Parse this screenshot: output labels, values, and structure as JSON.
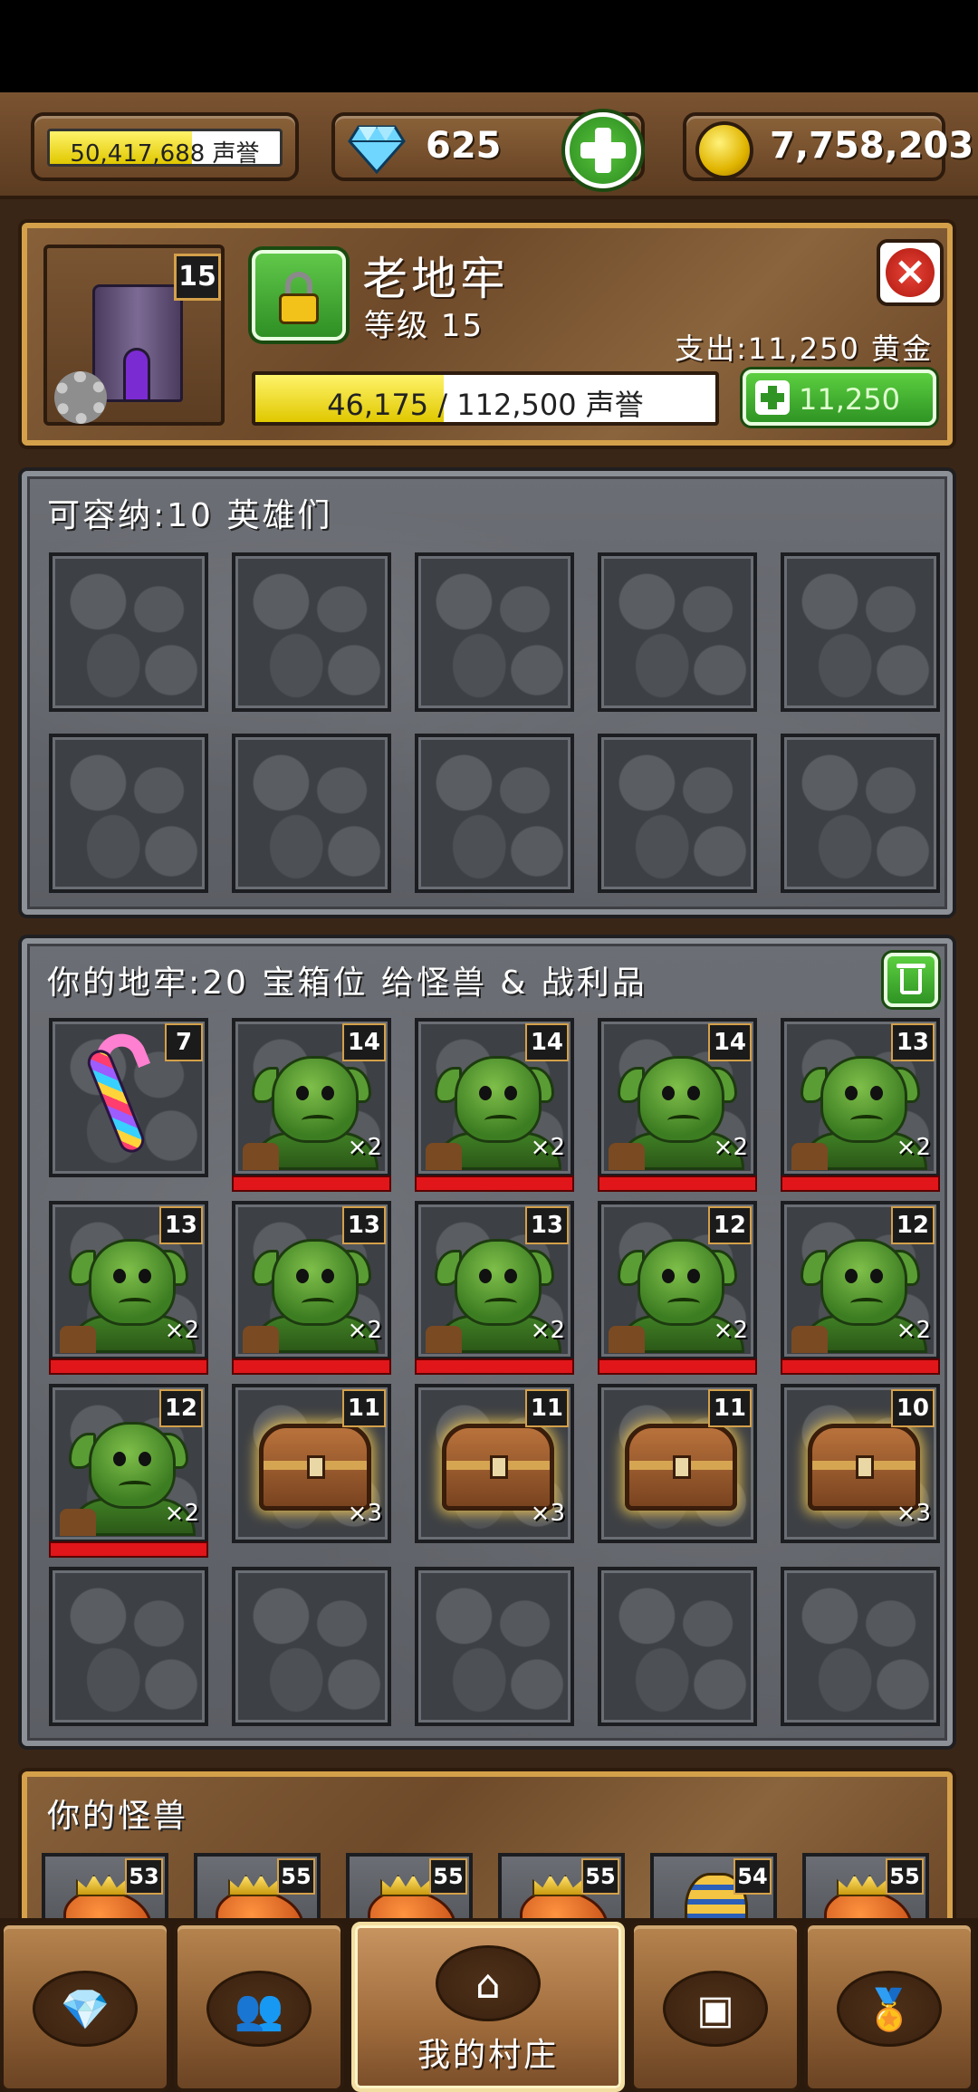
{
  "resources": {
    "reputation": "50,417,688 声誉",
    "reputation_fill_fraction": 0.62,
    "gems": "625",
    "gold": "7,758,203"
  },
  "dungeon": {
    "title": "老地牢",
    "level_text": "等级 15",
    "level_badge": "15",
    "cost_text": "支出:11,250 黄金",
    "xp_text": "46,175 / 112,500 声誉",
    "xp_fraction": 0.41,
    "upgrade_cost": "11,250"
  },
  "heroes": {
    "label": "可容纳:10 英雄们",
    "slots": 10
  },
  "storage": {
    "label": "你的地牢:20 宝箱位 给怪兽 & 战利品",
    "items": [
      {
        "type": "candy",
        "level": "7",
        "qty": ""
      },
      {
        "type": "orc",
        "level": "14",
        "qty": "×2"
      },
      {
        "type": "orc",
        "level": "14",
        "qty": "×2"
      },
      {
        "type": "orc",
        "level": "14",
        "qty": "×2"
      },
      {
        "type": "orc",
        "level": "13",
        "qty": "×2"
      },
      {
        "type": "orc",
        "level": "13",
        "qty": "×2"
      },
      {
        "type": "orc",
        "level": "13",
        "qty": "×2"
      },
      {
        "type": "orc",
        "level": "13",
        "qty": "×2"
      },
      {
        "type": "orc",
        "level": "12",
        "qty": "×2"
      },
      {
        "type": "orc",
        "level": "12",
        "qty": "×2"
      },
      {
        "type": "orc",
        "level": "12",
        "qty": "×2"
      },
      {
        "type": "chest",
        "level": "11",
        "qty": "×3"
      },
      {
        "type": "chest",
        "level": "11",
        "qty": "×3"
      },
      {
        "type": "chest",
        "level": "11",
        "qty": ""
      },
      {
        "type": "chest",
        "level": "10",
        "qty": "×3"
      },
      {
        "type": "empty",
        "level": "",
        "qty": ""
      },
      {
        "type": "empty",
        "level": "",
        "qty": ""
      },
      {
        "type": "empty",
        "level": "",
        "qty": ""
      },
      {
        "type": "empty",
        "level": "",
        "qty": ""
      },
      {
        "type": "empty",
        "level": "",
        "qty": ""
      }
    ]
  },
  "monsters": {
    "label": "你的怪兽",
    "cards": [
      {
        "type": "dragon",
        "level": "53"
      },
      {
        "type": "dragon",
        "level": "55"
      },
      {
        "type": "dragon",
        "level": "55"
      },
      {
        "type": "dragon",
        "level": "55"
      },
      {
        "type": "pharaoh",
        "level": "54"
      },
      {
        "type": "dragon",
        "level": "55"
      }
    ]
  },
  "nav": {
    "items": [
      {
        "icon": "gem-icon",
        "glyph": "💎",
        "label": ""
      },
      {
        "icon": "heroes-icon",
        "glyph": "👥",
        "label": ""
      },
      {
        "icon": "house-icon",
        "glyph": "⌂",
        "label": "我的村庄",
        "active": true
      },
      {
        "icon": "treasure-chest-icon",
        "glyph": "▣",
        "label": ""
      },
      {
        "icon": "medal-icon",
        "glyph": "🏅",
        "label": ""
      }
    ]
  },
  "colors": {
    "accent_gold": "#d4a04a",
    "button_green": "#2f9424",
    "hp_red": "#e0161a"
  }
}
